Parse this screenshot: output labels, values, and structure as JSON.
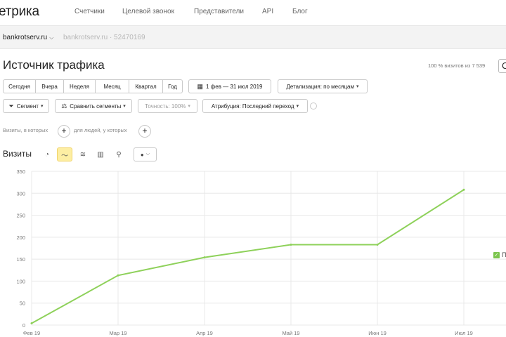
{
  "app": {
    "logo": "етрика"
  },
  "nav": {
    "items": [
      "Счетчики",
      "Целевой звонок",
      "Представители",
      "API",
      "Блог"
    ]
  },
  "counter": {
    "site": "bankrotserv.ru",
    "alt_site": "bankrotserv.ru · 52470169"
  },
  "report": {
    "title": "Источник трафика",
    "visits_share": "100 % визитов из 7 539"
  },
  "period": {
    "buttons": [
      "Сегодня",
      "Вчера",
      "Неделя",
      "Месяц",
      "Квартал",
      "Год"
    ],
    "date_range": "1 фев — 31 июл 2019",
    "detail": "Детализация: по месяцам"
  },
  "filters": {
    "segment": "Сегмент",
    "compare": "Сравнить сегменты",
    "accuracy": "Точность: 100%",
    "attribution": "Атрибуция: Последний переход"
  },
  "conditions": {
    "visits": "Визиты, в которых",
    "people": "для людей, у которых"
  },
  "chart_section": {
    "title": "Визиты",
    "icons": [
      "pie-icon",
      "line-chart-icon",
      "area-chart-icon",
      "bar-chart-icon",
      "map-pin-icon",
      "comment-icon"
    ]
  },
  "legend": {
    "label": "П"
  },
  "colors": {
    "series": "#8ed15a",
    "grid": "#e8e8e8",
    "active_control": "#fdeea3"
  },
  "chart_data": {
    "type": "line",
    "x": [
      "Фев 19",
      "Мар 19",
      "Апр 19",
      "Май 19",
      "Июн 19",
      "Июл 19"
    ],
    "y_ticks": [
      0,
      50,
      100,
      150,
      200,
      250,
      300,
      350
    ],
    "ylim": [
      0,
      350
    ],
    "grid": true,
    "legend_position": "right",
    "series": [
      {
        "values": [
          4,
          113,
          154,
          183,
          183,
          308
        ]
      }
    ]
  }
}
